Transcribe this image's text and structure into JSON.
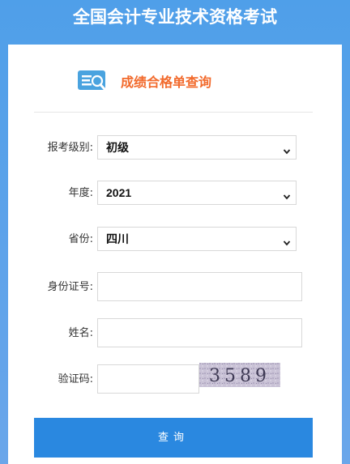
{
  "page": {
    "title": "全国会计专业技术资格考试"
  },
  "header": {
    "icon": "search-document-icon",
    "title": "成绩合格单查询"
  },
  "form": {
    "level": {
      "label": "报考级别:",
      "value": "初级"
    },
    "year": {
      "label": "年度:",
      "value": "2021"
    },
    "province": {
      "label": "省份:",
      "value": "四川"
    },
    "id_number": {
      "label": "身份证号:",
      "value": ""
    },
    "name": {
      "label": "姓名:",
      "value": ""
    },
    "captcha": {
      "label": "验证码:",
      "value": "",
      "code": "3589"
    }
  },
  "submit": {
    "label": "查询"
  },
  "colors": {
    "accent": "#2a88e0",
    "title_orange": "#f26a2c",
    "background": "#4f9fe9"
  }
}
